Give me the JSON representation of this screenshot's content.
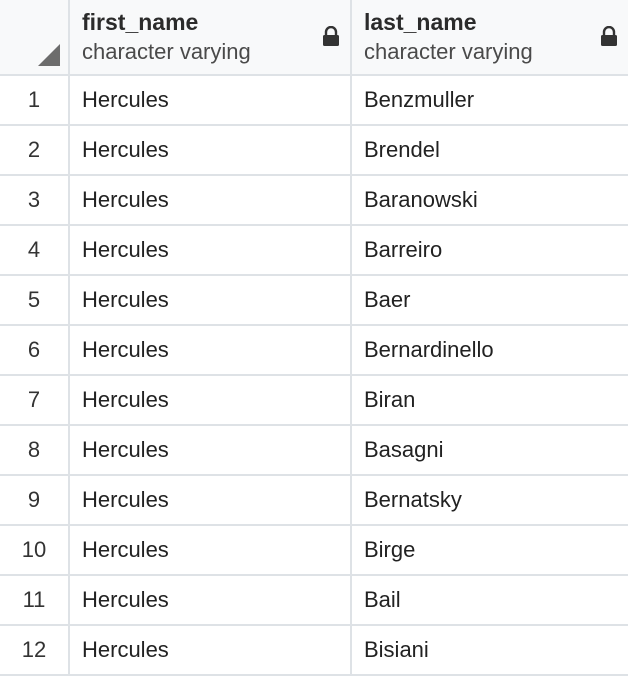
{
  "columns": [
    {
      "name": "first_name",
      "type": "character varying",
      "locked": true
    },
    {
      "name": "last_name",
      "type": "character varying",
      "locked": true
    }
  ],
  "rows": [
    {
      "num": "1",
      "first_name": "Hercules",
      "last_name": "Benzmuller"
    },
    {
      "num": "2",
      "first_name": "Hercules",
      "last_name": "Brendel"
    },
    {
      "num": "3",
      "first_name": "Hercules",
      "last_name": "Baranowski"
    },
    {
      "num": "4",
      "first_name": "Hercules",
      "last_name": "Barreiro"
    },
    {
      "num": "5",
      "first_name": "Hercules",
      "last_name": "Baer"
    },
    {
      "num": "6",
      "first_name": "Hercules",
      "last_name": "Bernardinello"
    },
    {
      "num": "7",
      "first_name": "Hercules",
      "last_name": "Biran"
    },
    {
      "num": "8",
      "first_name": "Hercules",
      "last_name": "Basagni"
    },
    {
      "num": "9",
      "first_name": "Hercules",
      "last_name": "Bernatsky"
    },
    {
      "num": "10",
      "first_name": "Hercules",
      "last_name": "Birge"
    },
    {
      "num": "11",
      "first_name": "Hercules",
      "last_name": "Bail"
    },
    {
      "num": "12",
      "first_name": "Hercules",
      "last_name": "Bisiani"
    }
  ],
  "icons": {
    "lock": "lock-icon",
    "corner": "select-all-corner-icon"
  },
  "colors": {
    "header_bg": "#f8f9fa",
    "grid_line": "#dee2e6",
    "text": "#222222"
  }
}
